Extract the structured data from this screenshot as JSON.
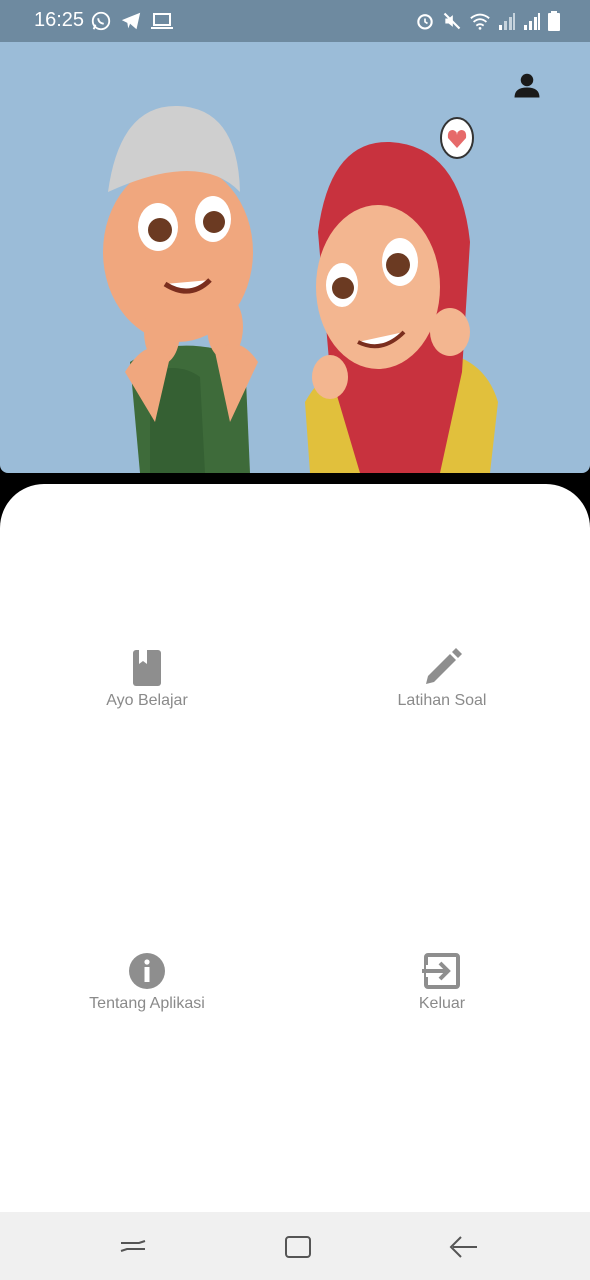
{
  "status_bar": {
    "time": "16:25",
    "left_icons": [
      "whatsapp-icon",
      "telegram-icon",
      "laptop-icon"
    ],
    "right_icons": [
      "alarm-icon",
      "mute-icon",
      "wifi-icon",
      "signal-icon",
      "signal-icon",
      "battery-icon"
    ]
  },
  "hero": {
    "profile_icon": "person-icon",
    "background_color": "#9bbcd8",
    "illustration": "two cartoon children smiling"
  },
  "menu": {
    "items": [
      {
        "label": "Ayo Belajar",
        "icon": "book-icon"
      },
      {
        "label": "Latihan Soal",
        "icon": "pencil-icon"
      },
      {
        "label": "Tentang Aplikasi",
        "icon": "info-icon"
      },
      {
        "label": "Keluar",
        "icon": "exit-icon"
      }
    ]
  },
  "nav_bar": {
    "buttons": [
      "recents-icon",
      "home-icon",
      "back-icon"
    ]
  }
}
